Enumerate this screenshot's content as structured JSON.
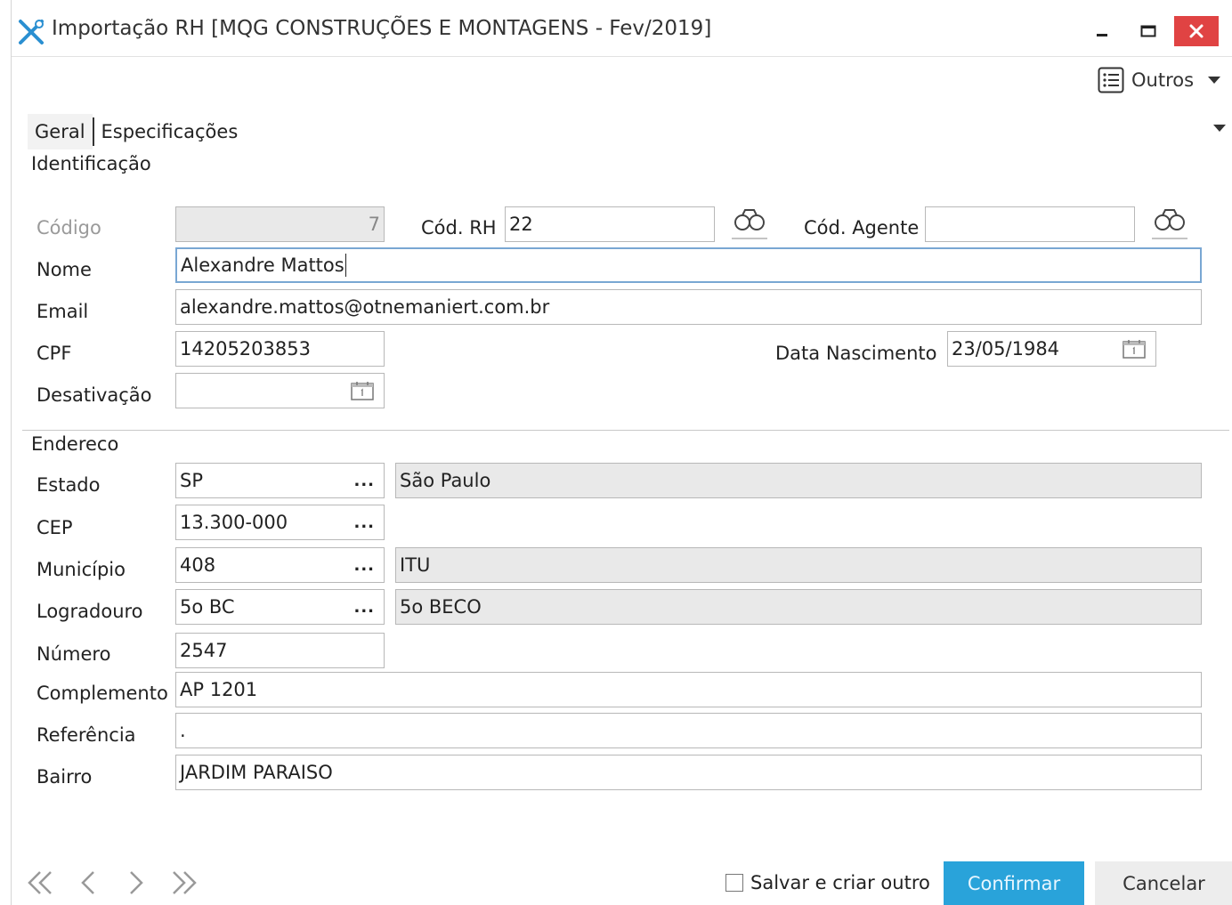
{
  "window": {
    "title": "Importação RH [MQG CONSTRUÇÕES E MONTAGENS - Fev/2019]",
    "icons": {
      "app": "tools-icon",
      "minimize": "minimize-icon",
      "maximize": "maximize-icon",
      "close": "close-icon"
    }
  },
  "toolbar": {
    "outros_label": "Outros",
    "outros_icon": "list-icon"
  },
  "tabs": [
    {
      "label": "Geral",
      "active": true
    },
    {
      "label": "Especificações",
      "active": false
    }
  ],
  "identificacao": {
    "section_title": "Identificação",
    "codigo": {
      "label": "Código",
      "value": "7"
    },
    "cod_rh": {
      "label": "Cód. RH",
      "value": "22"
    },
    "cod_agente": {
      "label": "Cód. Agente",
      "value": ""
    },
    "nome": {
      "label": "Nome",
      "value": "Alexandre Mattos"
    },
    "email": {
      "label": "Email",
      "value": "alexandre.mattos@otnemaniert.com.br"
    },
    "cpf": {
      "label": "CPF",
      "value": "14205203853"
    },
    "data_nascimento": {
      "label": "Data Nascimento",
      "value": "23/05/1984"
    },
    "desativacao": {
      "label": "Desativação",
      "value": ""
    }
  },
  "endereco": {
    "section_title": "Endereco",
    "estado": {
      "label": "Estado",
      "code": "SP",
      "description": "São Paulo"
    },
    "cep": {
      "label": "CEP",
      "value": "13.300-000"
    },
    "municipio": {
      "label": "Município",
      "code": "408",
      "description": "ITU"
    },
    "logradouro": {
      "label": "Logradouro",
      "code": "5o BC",
      "description": "5o BECO"
    },
    "numero": {
      "label": "Número",
      "value": "2547"
    },
    "complemento": {
      "label": "Complemento",
      "value": "AP 1201"
    },
    "referencia": {
      "label": "Referência",
      "value": "."
    },
    "bairro": {
      "label": "Bairro",
      "value": "JARDIM PARAISO"
    },
    "ellipsis": "..."
  },
  "footer": {
    "nav_icons": [
      "first-record-icon",
      "previous-record-icon",
      "next-record-icon",
      "last-record-icon"
    ],
    "save_and_new_label": "Salvar e criar outro",
    "save_and_new_checked": false,
    "confirm_label": "Confirmar",
    "cancel_label": "Cancelar"
  },
  "colors": {
    "accent": "#29a3da",
    "close": "#e04343",
    "focus": "#79a7d3"
  }
}
